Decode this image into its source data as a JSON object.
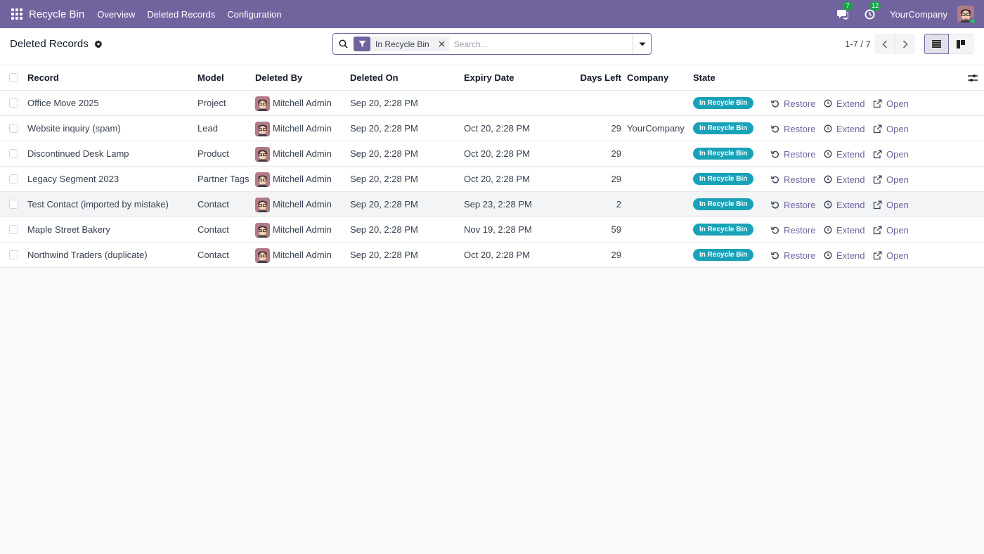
{
  "navbar": {
    "brand": "Recycle Bin",
    "menu": [
      "Overview",
      "Deleted Records",
      "Configuration"
    ],
    "messages_count": "7",
    "activities_count": "12",
    "company": "YourCompany",
    "accent_color": "#71639e"
  },
  "control_panel": {
    "title": "Deleted Records",
    "facet_label": "In Recycle Bin",
    "search_placeholder": "Search...",
    "pager": "1-7 / 7"
  },
  "table": {
    "columns": {
      "record": "Record",
      "model": "Model",
      "deleted_by": "Deleted By",
      "deleted_on": "Deleted On",
      "expiry_date": "Expiry Date",
      "days_left": "Days Left",
      "company": "Company",
      "state": "State"
    },
    "actions": {
      "restore": "Restore",
      "extend": "Extend",
      "open": "Open"
    },
    "state_color": "#17a2b8",
    "rows": [
      {
        "record": "Office Move 2025",
        "model": "Project",
        "deleted_by": "Mitchell Admin",
        "deleted_on": "Sep 20, 2:28 PM",
        "expiry": "",
        "days": "",
        "company": "",
        "state": "In Recycle Bin"
      },
      {
        "record": "Website inquiry (spam)",
        "model": "Lead",
        "deleted_by": "Mitchell Admin",
        "deleted_on": "Sep 20, 2:28 PM",
        "expiry": "Oct 20, 2:28 PM",
        "days": "29",
        "company": "YourCompany",
        "state": "In Recycle Bin"
      },
      {
        "record": "Discontinued Desk Lamp",
        "model": "Product",
        "deleted_by": "Mitchell Admin",
        "deleted_on": "Sep 20, 2:28 PM",
        "expiry": "Oct 20, 2:28 PM",
        "days": "29",
        "company": "",
        "state": "In Recycle Bin"
      },
      {
        "record": "Legacy Segment 2023",
        "model": "Partner Tags",
        "deleted_by": "Mitchell Admin",
        "deleted_on": "Sep 20, 2:28 PM",
        "expiry": "Oct 20, 2:28 PM",
        "days": "29",
        "company": "",
        "state": "In Recycle Bin"
      },
      {
        "record": "Test Contact (imported by mistake)",
        "model": "Contact",
        "deleted_by": "Mitchell Admin",
        "deleted_on": "Sep 20, 2:28 PM",
        "expiry": "Sep 23, 2:28 PM",
        "days": "2",
        "company": "",
        "state": "In Recycle Bin"
      },
      {
        "record": "Maple Street Bakery",
        "model": "Contact",
        "deleted_by": "Mitchell Admin",
        "deleted_on": "Sep 20, 2:28 PM",
        "expiry": "Nov 19, 2:28 PM",
        "days": "59",
        "company": "",
        "state": "In Recycle Bin"
      },
      {
        "record": "Northwind Traders (duplicate)",
        "model": "Contact",
        "deleted_by": "Mitchell Admin",
        "deleted_on": "Sep 20, 2:28 PM",
        "expiry": "Oct 20, 2:28 PM",
        "days": "29",
        "company": "",
        "state": "In Recycle Bin"
      }
    ]
  }
}
